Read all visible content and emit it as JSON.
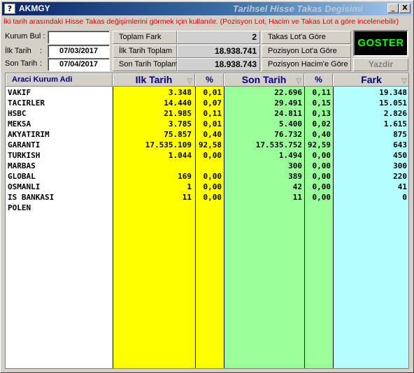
{
  "window": {
    "title": "AKMGY",
    "subtitle": "Tarihsel Hisse Takas Degisimi",
    "icon": "?",
    "minimize_glyph": "_",
    "close_glyph": "X"
  },
  "info_text": "İki tarih arasındaki Hisse Takas değişimlerini görmek için kullanılır. (Pozisyon Lot, Hacim ve Takas Lot a göre incelenebilir)",
  "form": {
    "kurum_bul_label": "Kurum Bul :",
    "kurum_bul_value": "",
    "ilk_tarih_label": "İlk Tarih",
    "ilk_tarih_colon": ":",
    "ilk_tarih_value": "07/03/2017",
    "son_tarih_label": "Son Tarih",
    "son_tarih_colon": ":",
    "son_tarih_value": "07/04/2017"
  },
  "summary": {
    "toplam_fark_label": "Toplam Fark",
    "toplam_fark_value": "2",
    "ilk_tarih_toplam_label": "İlk Tarih Toplam",
    "ilk_tarih_toplam_value": "18.938.741",
    "son_tarih_toplam_label": "Son Tarih Toplam",
    "son_tarih_toplam_value": "18.938.743"
  },
  "options": {
    "takas_lot": "Takas Lot'a Göre",
    "pozisyon_lot": "Pozisyon Lot'a Göre",
    "pozisyon_hacim": "Pozisyon Hacim'e Göre"
  },
  "buttons": {
    "goster": "GOSTER",
    "yazdir": "Yazdir"
  },
  "colors": {
    "ilk_tarih_column": "#ffff00",
    "son_tarih_column": "#99ff99",
    "fark_column": "#b3ffff",
    "info_text": "#e00000",
    "goster_text": "#00ff00"
  },
  "table": {
    "headers": {
      "aracikurum": "Araci Kurum Adi",
      "ilk_tarih": "Ilk Tarih",
      "ilk_pct": "%",
      "son_tarih": "Son Tarih",
      "son_pct": "%",
      "fark": "Fark",
      "sort_glyph": "▽"
    },
    "rows": [
      {
        "name": "VAKIF",
        "ilk": "3.348",
        "ilk_pct": "0,01",
        "son": "22.696",
        "son_pct": "0,11",
        "fark": "19.348"
      },
      {
        "name": "TACIRLER",
        "ilk": "14.440",
        "ilk_pct": "0,07",
        "son": "29.491",
        "son_pct": "0,15",
        "fark": "15.051"
      },
      {
        "name": "HSBC",
        "ilk": "21.985",
        "ilk_pct": "0,11",
        "son": "24.811",
        "son_pct": "0,13",
        "fark": "2.826"
      },
      {
        "name": "MEKSA",
        "ilk": "3.785",
        "ilk_pct": "0,01",
        "son": "5.400",
        "son_pct": "0,02",
        "fark": "1.615"
      },
      {
        "name": "AKYATIRIM",
        "ilk": "75.857",
        "ilk_pct": "0,40",
        "son": "76.732",
        "son_pct": "0,40",
        "fark": "875"
      },
      {
        "name": "GARANTI",
        "ilk": "17.535.109",
        "ilk_pct": "92,58",
        "son": "17.535.752",
        "son_pct": "92,59",
        "fark": "643"
      },
      {
        "name": "TURKISH",
        "ilk": "1.044",
        "ilk_pct": "0,00",
        "son": "1.494",
        "son_pct": "0,00",
        "fark": "450"
      },
      {
        "name": "MARBAS",
        "ilk": "",
        "ilk_pct": "",
        "son": "300",
        "son_pct": "0,00",
        "fark": "300"
      },
      {
        "name": "GLOBAL",
        "ilk": "169",
        "ilk_pct": "0,00",
        "son": "389",
        "son_pct": "0,00",
        "fark": "220"
      },
      {
        "name": "OSMANLI",
        "ilk": "1",
        "ilk_pct": "0,00",
        "son": "42",
        "son_pct": "0,00",
        "fark": "41"
      },
      {
        "name": "IS BANKASI",
        "ilk": "11",
        "ilk_pct": "0,00",
        "son": "11",
        "son_pct": "0,00",
        "fark": "0"
      },
      {
        "name": "POLEN",
        "ilk": "",
        "ilk_pct": "",
        "son": "",
        "son_pct": "",
        "fark": ""
      }
    ]
  }
}
